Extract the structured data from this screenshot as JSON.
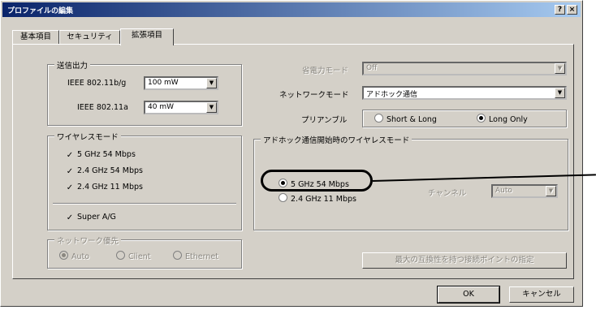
{
  "window": {
    "title": "プロファイルの編集",
    "help": "?",
    "close": "×"
  },
  "tabs": [
    {
      "label": "基本項目"
    },
    {
      "label": "セキュリティ"
    },
    {
      "label": "拡張項目"
    }
  ],
  "tx_power": {
    "title": "送信出力",
    "ieee_bg_label": "IEEE 802.11b/g",
    "ieee_bg_value": "100 mW",
    "ieee_a_label": "IEEE 802.11a",
    "ieee_a_value": "40 mW"
  },
  "wireless_mode": {
    "title": "ワイヤレスモード",
    "options": [
      {
        "label": "5 GHz 54 Mbps",
        "checked": true
      },
      {
        "label": "2.4 GHz 54 Mbps",
        "checked": true
      },
      {
        "label": "2.4 GHz 11 Mbps",
        "checked": true
      }
    ],
    "super_ag": "Super A/G"
  },
  "network_priority": {
    "title": "ネットワーク優先",
    "options": [
      "Auto",
      "Client",
      "Ethernet"
    ]
  },
  "right": {
    "power_save_label": "省電力モード",
    "power_save_value": "Off",
    "network_mode_label": "ネットワークモード",
    "network_mode_value": "アドホック通信",
    "preamble_label": "プリアンブル",
    "preamble_short": "Short & Long",
    "preamble_long": "Long Only"
  },
  "adhoc": {
    "title": "アドホック通信開始時のワイヤレスモード",
    "opt1": "5 GHz 54 Mbps",
    "opt2": "2.4 GHz 11 Mbps",
    "channel_label": "チャンネル",
    "channel_value": "Auto"
  },
  "buttons": {
    "advanced": "最大の互換性を持つ接続ポイントの指定",
    "ok": "OK",
    "cancel": "キャンセル"
  }
}
